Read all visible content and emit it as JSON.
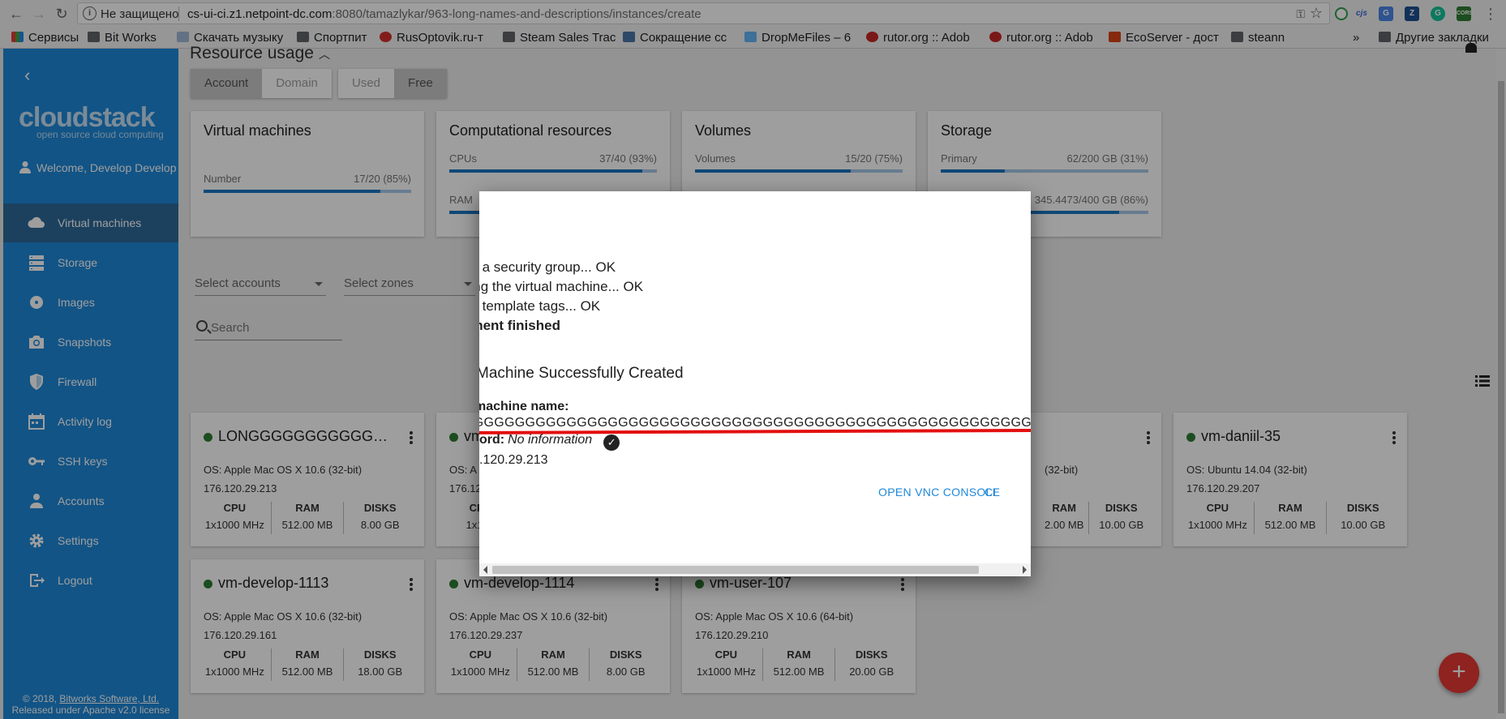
{
  "browser": {
    "insecure_label": "Не защищено",
    "url_host": "cs-ui-ci.z1.netpoint-dc.com",
    "url_rest": ":8080/tamazlykar/963-long-names-and-descriptions/instances/create",
    "extensions": [
      "cjs",
      "Z",
      "CORS"
    ],
    "bookmarks": [
      "Сервисы",
      "Bit Works",
      "Скачать музыку",
      "Спортпит",
      "RusOptovik.ru-т",
      "Steam Sales Trac",
      "Сокращение сс",
      "DropMeFiles – 6",
      "rutor.org :: Adob",
      "rutor.org :: Adob",
      "EcoServer - дост",
      "steann"
    ],
    "more_bookmarks": "»",
    "other_bookmarks": "Другие закладки"
  },
  "sidebar": {
    "back": "‹",
    "logo": "cloudstack",
    "tagline": "open source cloud computing",
    "welcome": "Welcome, Develop Develop",
    "items": [
      {
        "label": "Virtual machines",
        "icon": "cloud-icon"
      },
      {
        "label": "Storage",
        "icon": "storage-icon"
      },
      {
        "label": "Images",
        "icon": "disc-icon"
      },
      {
        "label": "Snapshots",
        "icon": "camera-icon"
      },
      {
        "label": "Firewall",
        "icon": "shield-icon"
      },
      {
        "label": "Activity log",
        "icon": "calendar-icon"
      },
      {
        "label": "SSH keys",
        "icon": "key-icon"
      },
      {
        "label": "Accounts",
        "icon": "person-icon"
      },
      {
        "label": "Settings",
        "icon": "gear-icon"
      },
      {
        "label": "Logout",
        "icon": "logout-icon"
      }
    ],
    "footer_prefix": "© 2018, ",
    "footer_link": "Bitworks Software, Ltd.",
    "footer_line2": "Released under Apache v2.0 license"
  },
  "main": {
    "resource_title": "Resource usage",
    "scope_tabs": [
      "Account",
      "Domain"
    ],
    "mode_tabs": [
      "Used",
      "Free"
    ],
    "cards": {
      "vm": {
        "title": "Virtual machines",
        "stats": [
          {
            "label": "Number",
            "value": "17/20 (85%)",
            "pct": 85
          }
        ]
      },
      "compute": {
        "title": "Computational resources",
        "stats": [
          {
            "label": "CPUs",
            "value": "37/40 (93%)",
            "pct": 93
          },
          {
            "label": "RAM",
            "value": "",
            "pct": 50
          }
        ]
      },
      "volumes": {
        "title": "Volumes",
        "stats": [
          {
            "label": "Volumes",
            "value": "15/20 (75%)",
            "pct": 75
          }
        ]
      },
      "storage": {
        "title": "Storage",
        "stats": [
          {
            "label": "Primary",
            "value": "62/200 GB (31%)",
            "pct": 31
          },
          {
            "label": "",
            "value": "345.4473/400 GB (86%)",
            "pct": 86
          }
        ]
      }
    },
    "filter_accounts": "Select accounts",
    "filter_zones": "Select zones",
    "search_placeholder": "Search",
    "spec_headers": {
      "cpu": "CPU",
      "ram": "RAM",
      "disks": "DISKS"
    },
    "vms": [
      {
        "name": "LONGGGGGGGGGGGGG...",
        "os": "OS: Apple Mac OS X 10.6 (32-bit)",
        "ip": "176.120.29.213",
        "cpu": "1x1000 MHz",
        "ram": "512.00 MB",
        "disks": "8.00 GB"
      },
      {
        "name": "vm",
        "os": "OS: A",
        "ip": "176.12",
        "cpu": "1x100",
        "ram": "",
        "disks": ""
      },
      {
        "name": "",
        "os": "(32-bit)",
        "ip": "",
        "cpu": "",
        "ram": "2.00 MB",
        "disks": "10.00 GB"
      },
      {
        "name": "vm-daniil-35",
        "os": "OS: Ubuntu 14.04 (32-bit)",
        "ip": "176.120.29.207",
        "cpu": "1x1000 MHz",
        "ram": "512.00 MB",
        "disks": "10.00 GB"
      },
      {
        "name": "vm-develop-1113",
        "os": "OS: Apple Mac OS X 10.6 (32-bit)",
        "ip": "176.120.29.161",
        "cpu": "1x1000 MHz",
        "ram": "512.00 MB",
        "disks": "18.00 GB"
      },
      {
        "name": "vm-develop-1114",
        "os": "OS: Apple Mac OS X 10.6 (32-bit)",
        "ip": "176.120.29.237",
        "cpu": "1x1000 MHz",
        "ram": "512.00 MB",
        "disks": "8.00 GB"
      },
      {
        "name": "vm-user-107",
        "os": "OS: Apple Mac OS X 10.6 (64-bit)",
        "ip": "176.120.29.210",
        "cpu": "1x1000 MHz",
        "ram": "512.00 MB",
        "disks": "20.00 GB"
      }
    ],
    "fab": "+"
  },
  "dialog": {
    "log_lines": [
      "ng a security group... OK",
      "ving the virtual machine... OK",
      "ng template tags... OK"
    ],
    "finished": "yment finished",
    "title": "Machine Successfully Created",
    "vm_name_label": "machine name:",
    "vm_name_value": "GGGGGGGGGGGGGGGGGGGGGGGGGGGGGGGGGGGGGGGGGGGGGGGGGGGGGGGG",
    "password_label": "ord:",
    "password_value": "No information",
    "ip": ".120.29.213",
    "vnc_button": "OPEN VNC CONSOLE",
    "close_button": "CL"
  }
}
